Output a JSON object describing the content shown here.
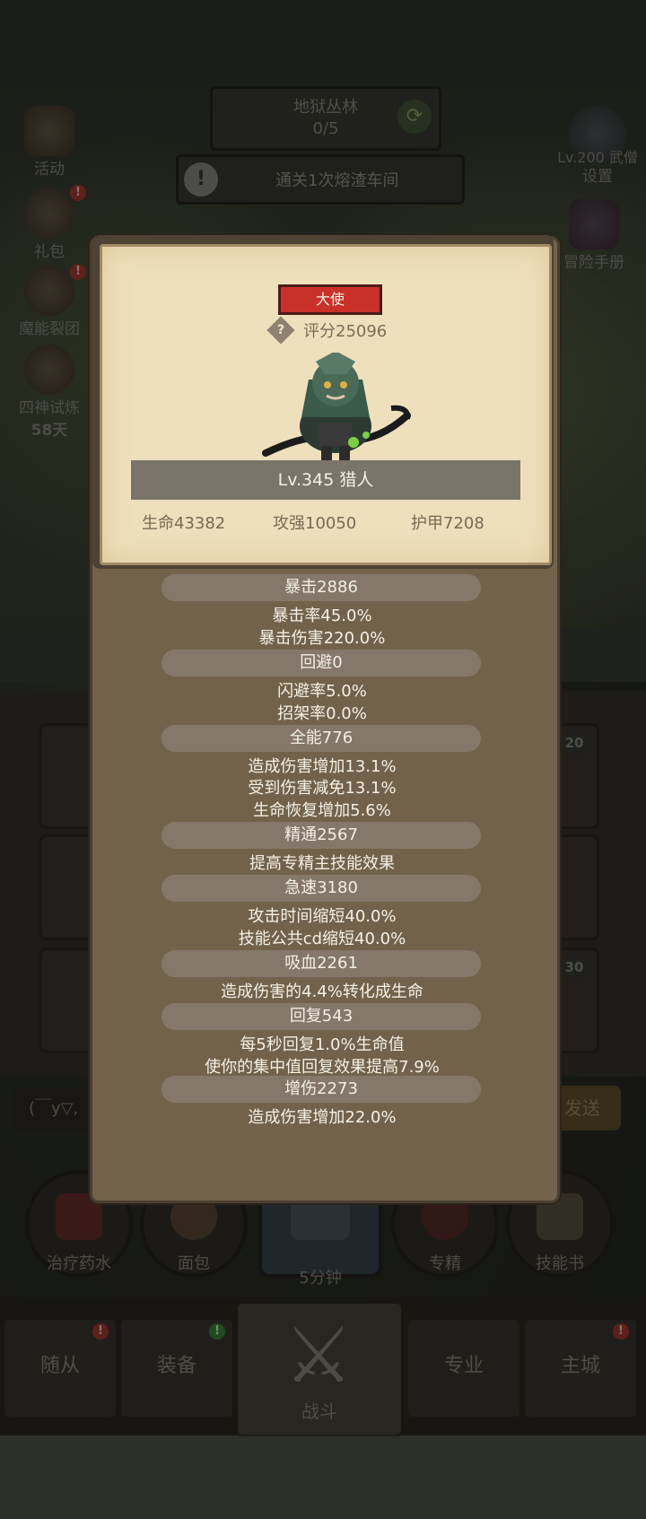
{
  "background": {
    "zone": {
      "name": "地狱丛林",
      "progress": "0/5"
    },
    "quest": {
      "text": "通关1次熔渣车间",
      "icon": "exclamation-icon"
    },
    "left_menu": [
      {
        "label": "活动"
      },
      {
        "label": "礼包"
      },
      {
        "label": "魔能裂团"
      },
      {
        "label": "四神试炼",
        "sub": "58天"
      }
    ],
    "right_menu": [
      {
        "label": "设置",
        "overlay": "Lv.200 武僧"
      },
      {
        "label": "冒险手册"
      }
    ],
    "chat": {
      "placeholder": "(￣y▽,",
      "send_label": "发送"
    },
    "slot_badges": [
      "20",
      "30"
    ],
    "bottom_items": [
      {
        "label": "治疗药水"
      },
      {
        "label": "面包"
      },
      {
        "label": "5分钟"
      },
      {
        "label": "专精"
      },
      {
        "label": "技能书"
      }
    ],
    "tabs": [
      {
        "label": "随从"
      },
      {
        "label": "装备"
      },
      {
        "label": "战斗"
      },
      {
        "label": "专业"
      },
      {
        "label": "主城"
      }
    ],
    "badge_mark": "!"
  },
  "card": {
    "role_badge": "大使",
    "help_glyph": "?",
    "score": "评分25096",
    "name": "Lv.345 猎人",
    "stats": {
      "hp": "生命43382",
      "attack": "攻强10050",
      "armor": "护甲7208"
    }
  },
  "attributes": [
    {
      "header": "暴击2886",
      "lines": [
        "暴击率45.0%",
        "暴击伤害220.0%"
      ]
    },
    {
      "header": "回避0",
      "lines": [
        "闪避率5.0%",
        "招架率0.0%"
      ]
    },
    {
      "header": "全能776",
      "lines": [
        "造成伤害增加13.1%",
        "受到伤害减免13.1%",
        "生命恢复增加5.6%"
      ]
    },
    {
      "header": "精通2567",
      "lines": [
        "提高专精主技能效果"
      ]
    },
    {
      "header": "急速3180",
      "lines": [
        "攻击时间缩短40.0%",
        "技能公共cd缩短40.0%"
      ]
    },
    {
      "header": "吸血2261",
      "lines": [
        "造成伤害的4.4%转化成生命"
      ]
    },
    {
      "header": "回复543",
      "lines": [
        "每5秒回复1.0%生命值",
        "使你的集中值回复效果提高7.9%"
      ]
    },
    {
      "header": "增伤2273",
      "lines": [
        "造成伤害增加22.0%"
      ]
    }
  ],
  "colors": {
    "modal_bg": "#72624c",
    "parchment": "#eedfbd",
    "badge_red": "#c9302a",
    "attr_header": "#85786a",
    "text_light": "#f5f0e6"
  }
}
